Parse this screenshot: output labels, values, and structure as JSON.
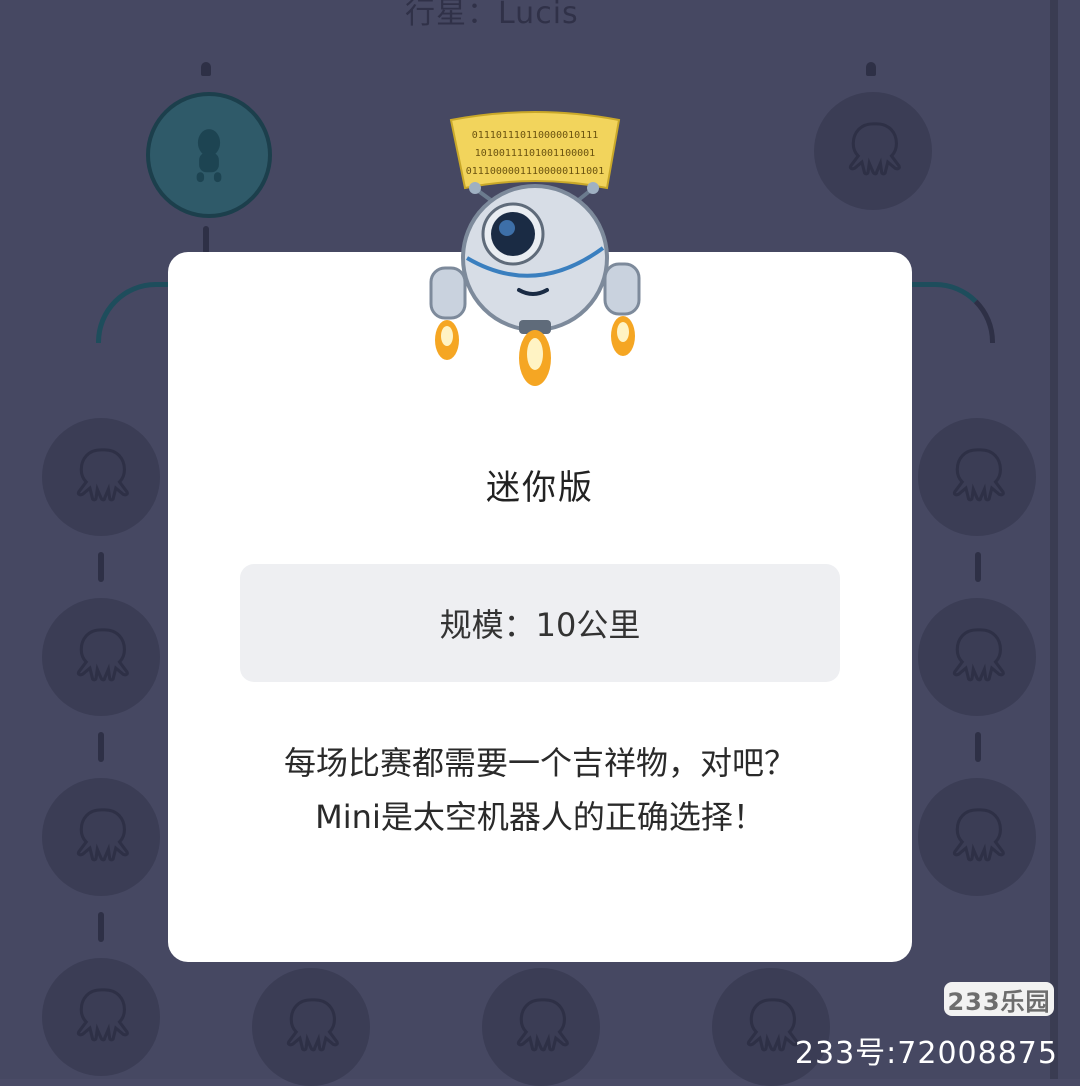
{
  "background": {
    "planet_label": "行星：Lucis",
    "left_branch_label": "",
    "right_branch_label": ""
  },
  "dialog": {
    "title": "迷你版",
    "scale_text": "规模：10公里",
    "description_line1": "每场比赛都需要一个吉祥物，对吧？",
    "description_line2": "Mini是太空机器人的正确选择！"
  },
  "mascot": {
    "binary_line1": "011101110110000010111",
    "binary_line2": "10100111101001100001",
    "binary_line3": "01110000011100000111001"
  },
  "watermark": {
    "logo_text": "233乐园",
    "id_text": "233号:72008875"
  },
  "colors": {
    "backdrop": "#464862",
    "dialog_bg": "#ffffff",
    "scale_box": "#eeeff2",
    "accent_teal": "#2f5a69"
  }
}
